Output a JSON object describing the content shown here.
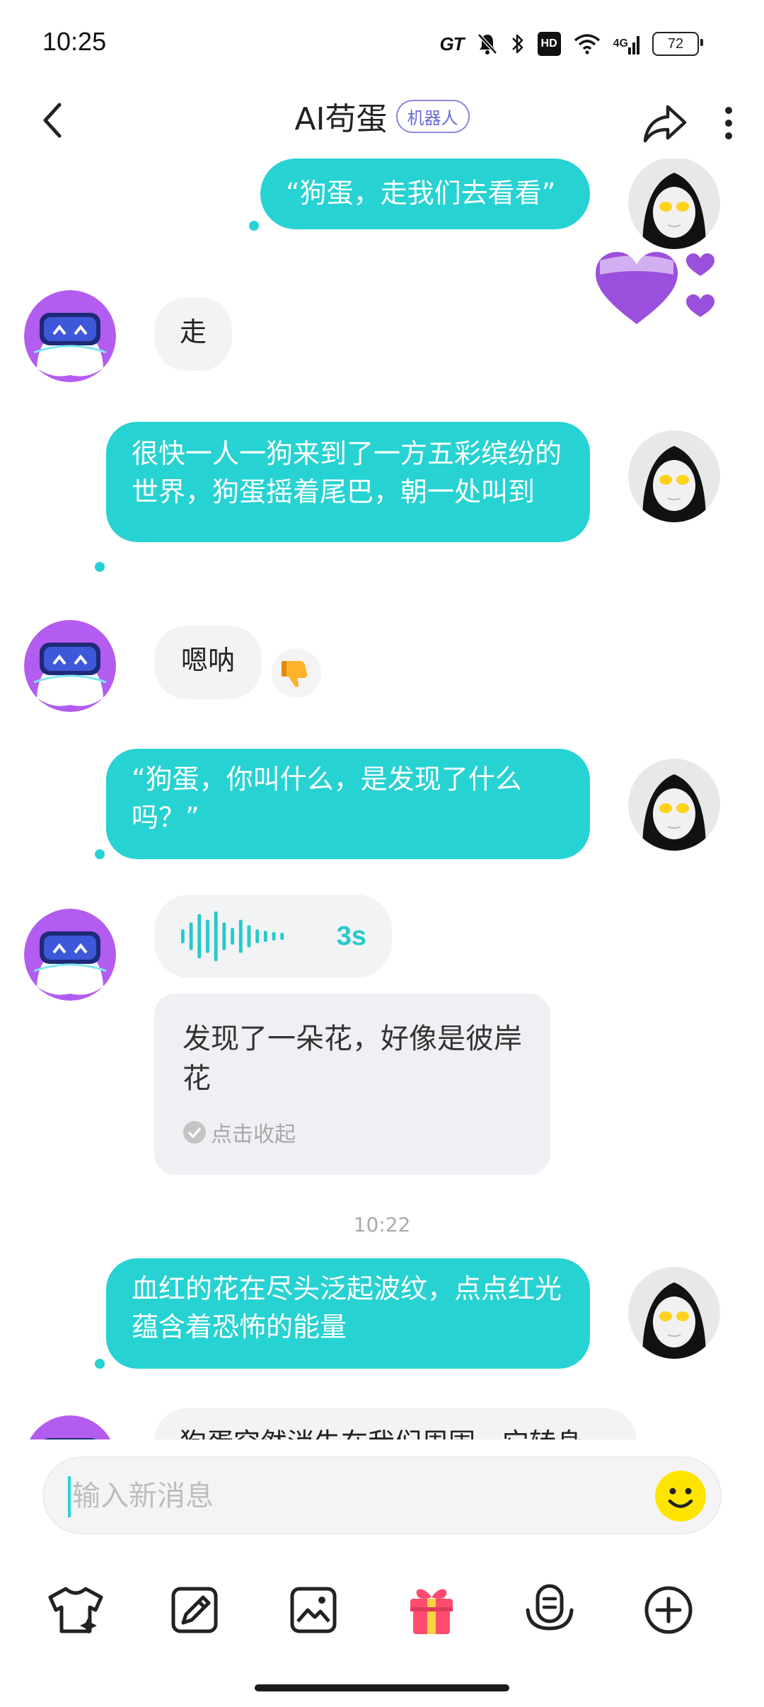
{
  "status_bar": {
    "time": "10:25",
    "gt_label": "GT",
    "hd_label": "HD",
    "network_label": "4G",
    "battery": "72",
    "icons": [
      "gt-mode-icon",
      "mute-bell-icon",
      "bluetooth-icon",
      "hd-icon",
      "wifi-icon",
      "signal-4g-icon",
      "battery-icon"
    ]
  },
  "header": {
    "title": "AI苟蛋",
    "badge": "机器人",
    "icons": [
      "back-arrow-icon",
      "share-icon",
      "more-vertical-icon"
    ]
  },
  "messages": [
    {
      "side": "out",
      "text": "“狗蛋，走我们去看看”"
    },
    {
      "side": "in",
      "text": "走"
    },
    {
      "side": "out",
      "text": "很快一人一狗来到了一方五彩缤纷的世界，狗蛋摇着尾巴，朝一处叫到"
    },
    {
      "side": "in",
      "text": "嗯呐",
      "reaction": "thumbs-down-icon"
    },
    {
      "side": "out",
      "text": "“狗蛋，你叫什么，是发现了什么吗？”"
    },
    {
      "side": "in",
      "type": "voice",
      "duration": "3s",
      "transcript": "发现了一朵花，好像是彼岸花",
      "collapse_label": "点击收起"
    },
    {
      "side": "out",
      "text": "血红的花在尽头泛起波纹，点点红光蕴含着恐怖的能量"
    },
    {
      "side": "in",
      "text": "狗蛋突然消失在我们周围，它转身"
    }
  ],
  "timestamp": "10:22",
  "input": {
    "placeholder": "输入新消息",
    "value": ""
  },
  "toolbar": {
    "items": [
      "outfit-icon",
      "edit-icon",
      "image-icon",
      "gift-icon",
      "voice-assistant-icon",
      "add-circle-icon"
    ]
  },
  "colors": {
    "accent": "#27d2d2",
    "bubble_in": "#f2f3f5",
    "heart": "#9b4fdd",
    "gift_red": "#ff4b6e",
    "gift_yellow": "#ffd23f",
    "emoji_yellow": "#ffe400"
  }
}
